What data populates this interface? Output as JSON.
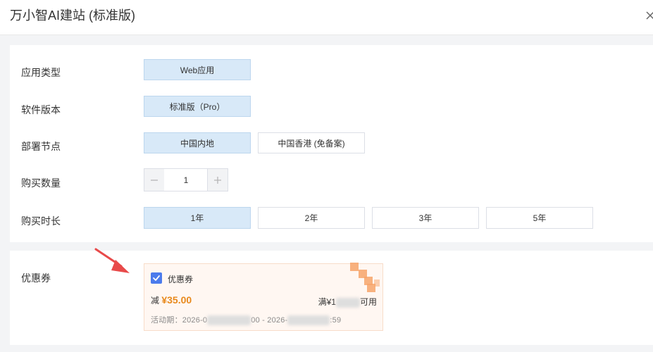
{
  "dialog": {
    "title": "万小智AI建站 (标准版)"
  },
  "form": {
    "app_type": {
      "label": "应用类型",
      "options": [
        "Web应用"
      ]
    },
    "version": {
      "label": "软件版本",
      "options": [
        "标准版（Pro）"
      ]
    },
    "node": {
      "label": "部署节点",
      "options": [
        "中国内地",
        "中国香港 (免备案)"
      ]
    },
    "quantity": {
      "label": "购买数量",
      "value": "1"
    },
    "duration": {
      "label": "购买时长",
      "options": [
        "1年",
        "2年",
        "3年",
        "5年"
      ]
    }
  },
  "coupon": {
    "label": "优惠券",
    "checkbox_label": "优惠券",
    "discount_prefix": "减",
    "discount_amount": "¥35.00",
    "threshold_prefix": "满¥1",
    "threshold_suffix": "可用",
    "period_prefix": "活动期：2026-0",
    "period_middle": "00 - 2026-",
    "period_suffix": ":59"
  },
  "colors": {
    "selected_bg": "#d8e9f8",
    "accent_amount": "#e8891c",
    "checkbox": "#4b7bec",
    "arrow": "#e84a4a"
  }
}
